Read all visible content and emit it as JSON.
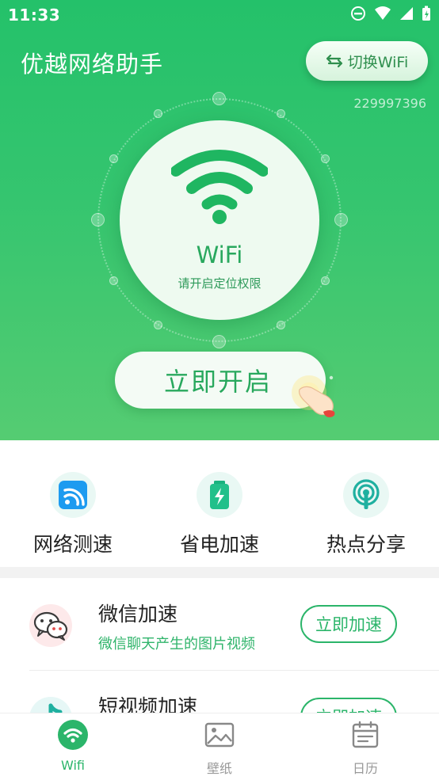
{
  "status_bar": {
    "time": "11:33"
  },
  "header": {
    "title": "优越网络助手",
    "switch_label": "切换WiFi",
    "version": "229997396"
  },
  "wifi_panel": {
    "label": "WiFi",
    "subtitle": "请开启定位权限",
    "open_button": "立即开启"
  },
  "quick_actions": [
    {
      "label": "网络测速",
      "icon": "speed-test-icon"
    },
    {
      "label": "省电加速",
      "icon": "battery-icon"
    },
    {
      "label": "热点分享",
      "icon": "hotspot-icon"
    }
  ],
  "list": [
    {
      "title": "微信加速",
      "desc": "微信聊天产生的图片视频",
      "button": "立即加速"
    },
    {
      "title": "短视频加速",
      "desc": "",
      "button": "立即加速"
    }
  ],
  "bottom_nav": [
    {
      "label": "Wifi",
      "active": true
    },
    {
      "label": "壁纸",
      "active": false
    },
    {
      "label": "日历",
      "active": false
    }
  ],
  "colors": {
    "primary": "#2bb56a",
    "hero_top": "#24c16a",
    "hero_bottom": "#55cc72"
  }
}
